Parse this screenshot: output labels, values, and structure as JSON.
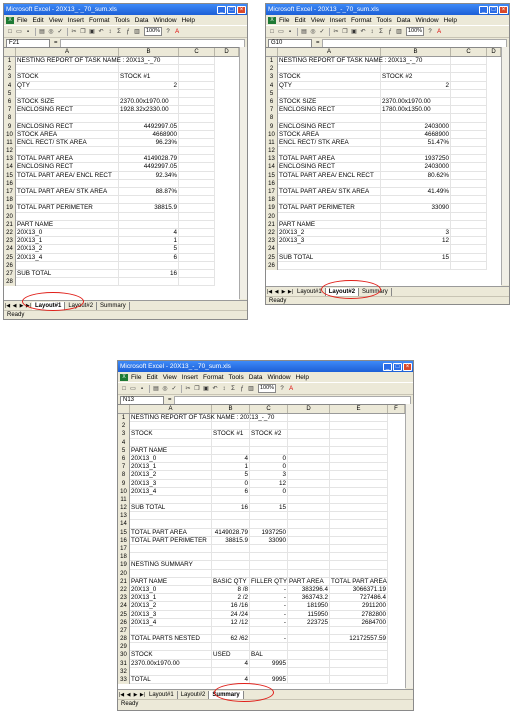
{
  "menu": [
    "File",
    "Edit",
    "View",
    "Insert",
    "Format",
    "Tools",
    "Data",
    "Window",
    "Help"
  ],
  "zoom": "100%",
  "colors": {
    "highlight": "#e0201a",
    "title_bar": "#1c5fd6"
  },
  "win1": {
    "title": "Microsoft Excel - 20X13_-_70_sum.xls",
    "namebox": "F21",
    "status": "Ready",
    "cols": [
      "A",
      "B",
      "C",
      "D"
    ],
    "tabs": [
      "Layout#1",
      "Layout#2",
      "Summary"
    ],
    "active_tab": 0,
    "rows": [
      [
        "1",
        "NESTING REPORT OF TASK NAME : 20X13_-_70",
        "",
        ""
      ],
      [
        "2",
        "",
        "",
        ""
      ],
      [
        "3",
        "STOCK",
        "STOCK #1",
        ""
      ],
      [
        "4",
        "QTY",
        "2",
        ""
      ],
      [
        "5",
        "",
        "",
        ""
      ],
      [
        "6",
        "STOCK SIZE",
        "2370.00x1970.00",
        ""
      ],
      [
        "7",
        "ENCLOSING RECT",
        "1928.32x2330.00",
        ""
      ],
      [
        "8",
        "",
        "",
        ""
      ],
      [
        "9",
        "ENCLOSING RECT",
        "4492997.05",
        ""
      ],
      [
        "10",
        "STOCK AREA",
        "4668900",
        ""
      ],
      [
        "11",
        "ENCL RECT/ STK AREA",
        "96.23%",
        ""
      ],
      [
        "12",
        "",
        "",
        ""
      ],
      [
        "13",
        "TOTAL PART AREA",
        "4149028.79",
        ""
      ],
      [
        "14",
        "ENCLOSING RECT",
        "4492997.05",
        ""
      ],
      [
        "15",
        "TOTAL PART AREA/ ENCL RECT",
        "92.34%",
        ""
      ],
      [
        "16",
        "",
        "",
        ""
      ],
      [
        "17",
        "TOTAL PART AREA/ STK AREA",
        "88.87%",
        ""
      ],
      [
        "18",
        "",
        "",
        ""
      ],
      [
        "19",
        "TOTAL PART PERIMETER",
        "38815.9",
        ""
      ],
      [
        "20",
        "",
        "",
        ""
      ],
      [
        "21",
        "PART NAME",
        "",
        ""
      ],
      [
        "22",
        "20X13_0",
        "4",
        ""
      ],
      [
        "23",
        "20X13_1",
        "1",
        ""
      ],
      [
        "24",
        "20X13_2",
        "5",
        ""
      ],
      [
        "25",
        "20X13_4",
        "6",
        ""
      ],
      [
        "26",
        "",
        "",
        ""
      ],
      [
        "27",
        "SUB TOTAL",
        "16",
        ""
      ],
      [
        "28",
        "",
        "",
        ""
      ]
    ]
  },
  "win2": {
    "title": "Microsoft Excel - 20X13_-_70_sum.xls",
    "namebox": "G10",
    "status": "Ready",
    "cols": [
      "A",
      "B",
      "C",
      "D"
    ],
    "tabs": [
      "Layout#1",
      "Layout#2",
      "Summary"
    ],
    "active_tab": 1,
    "rows": [
      [
        "1",
        "NESTING REPORT OF TASK NAME : 20X13_-_70",
        "",
        ""
      ],
      [
        "2",
        "",
        "",
        ""
      ],
      [
        "3",
        "STOCK",
        "STOCK #2",
        ""
      ],
      [
        "4",
        "QTY",
        "2",
        ""
      ],
      [
        "5",
        "",
        "",
        ""
      ],
      [
        "6",
        "STOCK SIZE",
        "2370.00x1970.00",
        ""
      ],
      [
        "7",
        "ENCLOSING RECT",
        "1780.00x1350.00",
        ""
      ],
      [
        "8",
        "",
        "",
        ""
      ],
      [
        "9",
        "ENCLOSING RECT",
        "2403000",
        ""
      ],
      [
        "10",
        "STOCK AREA",
        "4668900",
        ""
      ],
      [
        "11",
        "ENCL RECT/ STK AREA",
        "51.47%",
        ""
      ],
      [
        "12",
        "",
        "",
        ""
      ],
      [
        "13",
        "TOTAL PART AREA",
        "1937250",
        ""
      ],
      [
        "14",
        "ENCLOSING RECT",
        "2403000",
        ""
      ],
      [
        "15",
        "TOTAL PART AREA/ ENCL RECT",
        "80.62%",
        ""
      ],
      [
        "16",
        "",
        "",
        ""
      ],
      [
        "17",
        "TOTAL PART AREA/ STK AREA",
        "41.49%",
        ""
      ],
      [
        "18",
        "",
        "",
        ""
      ],
      [
        "19",
        "TOTAL PART PERIMETER",
        "33090",
        ""
      ],
      [
        "20",
        "",
        "",
        ""
      ],
      [
        "21",
        "PART NAME",
        "",
        ""
      ],
      [
        "22",
        "20X13_2",
        "3",
        ""
      ],
      [
        "23",
        "20X13_3",
        "12",
        ""
      ],
      [
        "24",
        "",
        "",
        ""
      ],
      [
        "25",
        "SUB TOTAL",
        "15",
        ""
      ],
      [
        "26",
        "",
        "",
        ""
      ]
    ]
  },
  "win3": {
    "title": "Microsoft Excel - 20X13_-_70_sum.xls",
    "namebox": "N13",
    "status": "Ready",
    "cols": [
      "A",
      "B",
      "C",
      "D",
      "E",
      "F"
    ],
    "tabs": [
      "Layout#1",
      "Layout#2",
      "Summary"
    ],
    "active_tab": 2,
    "rows": [
      [
        "1",
        "NESTING REPORT OF TASK NAME : 20X13_-_70",
        "",
        "",
        "",
        ""
      ],
      [
        "2",
        "",
        "",
        "",
        "",
        ""
      ],
      [
        "3",
        "STOCK",
        "STOCK #1",
        "STOCK #2",
        "",
        ""
      ],
      [
        "4",
        "",
        "",
        "",
        "",
        ""
      ],
      [
        "5",
        "PART NAME",
        "",
        "",
        "",
        ""
      ],
      [
        "6",
        "20X13_0",
        "4",
        "0",
        "",
        ""
      ],
      [
        "7",
        "20X13_1",
        "1",
        "0",
        "",
        ""
      ],
      [
        "8",
        "20X13_2",
        "5",
        "3",
        "",
        ""
      ],
      [
        "9",
        "20X13_3",
        "0",
        "12",
        "",
        ""
      ],
      [
        "10",
        "20X13_4",
        "6",
        "0",
        "",
        ""
      ],
      [
        "11",
        "",
        "",
        "",
        "",
        ""
      ],
      [
        "12",
        "SUB TOTAL",
        "16",
        "15",
        "",
        ""
      ],
      [
        "13",
        "",
        "",
        "",
        "",
        ""
      ],
      [
        "14",
        "",
        "",
        "",
        "",
        ""
      ],
      [
        "15",
        "TOTAL PART AREA",
        "4149028.79",
        "1937250",
        "",
        ""
      ],
      [
        "16",
        "TOTAL PART PERIMETER",
        "38815.9",
        "33090",
        "",
        ""
      ],
      [
        "17",
        "",
        "",
        "",
        "",
        ""
      ],
      [
        "18",
        "",
        "",
        "",
        "",
        ""
      ],
      [
        "19",
        "NESTING SUMMARY",
        "",
        "",
        "",
        ""
      ],
      [
        "20",
        "",
        "",
        "",
        "",
        ""
      ],
      [
        "21",
        "PART NAME",
        "BASIC QTY",
        "FILLER QTY",
        "PART AREA",
        "TOTAL PART AREA"
      ],
      [
        "22",
        "20X13_0",
        "8 /8",
        "-",
        "383296.4",
        "3066371.19"
      ],
      [
        "23",
        "20X13_1",
        "2 /2",
        "-",
        "363743.2",
        "727486.4"
      ],
      [
        "24",
        "20X13_2",
        "16 /16",
        "-",
        "181950",
        "2911200"
      ],
      [
        "25",
        "20X13_3",
        "24 /24",
        "-",
        "115950",
        "2782800"
      ],
      [
        "26",
        "20X13_4",
        "12 /12",
        "-",
        "223725",
        "2684700"
      ],
      [
        "27",
        "",
        "",
        "",
        "",
        ""
      ],
      [
        "28",
        "TOTAL PARTS NESTED",
        "62 /62",
        "-",
        "",
        "12172557.59"
      ],
      [
        "29",
        "",
        "",
        "",
        "",
        ""
      ],
      [
        "30",
        "STOCK",
        "USED",
        "BAL",
        "",
        ""
      ],
      [
        "31",
        "2370.00x1970.00",
        "4",
        "9995",
        "",
        ""
      ],
      [
        "32",
        "",
        "",
        "",
        "",
        ""
      ],
      [
        "33",
        "TOTAL",
        "4",
        "9995",
        "",
        ""
      ]
    ]
  }
}
